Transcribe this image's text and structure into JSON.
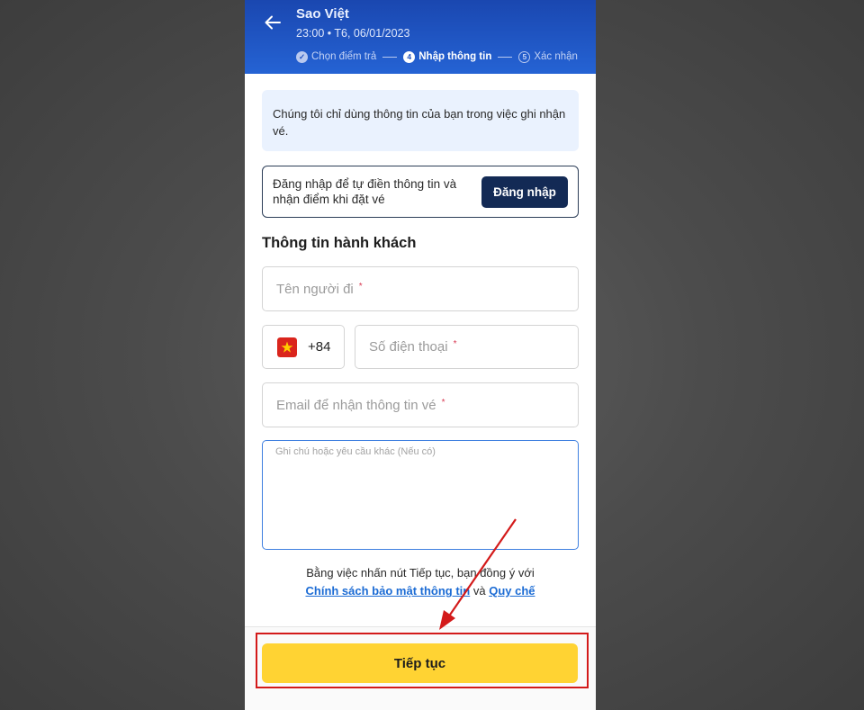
{
  "header": {
    "operator": "Sao Việt",
    "trip_time": "23:00 • T6, 06/01/2023",
    "steps": [
      {
        "number": "✓",
        "label": "Chọn điểm trả",
        "state": "done"
      },
      {
        "number": "4",
        "label": "Nhập thông tin",
        "state": "current"
      },
      {
        "number": "5",
        "label": "Xác nhận",
        "state": "next"
      }
    ]
  },
  "info_notice": "Chúng tôi chỉ dùng thông tin của bạn trong việc ghi nhận vé.",
  "login_prompt": {
    "text": "Đăng nhập để tự điền thông tin và nhận điểm khi đặt vé",
    "button_label": "Đăng nhập"
  },
  "passenger_section": {
    "title": "Thông tin hành khách",
    "name_placeholder": "Tên người đi",
    "country_code": "+84",
    "phone_placeholder": "Số điện thoại",
    "email_placeholder": "Email để nhận thông tin vé",
    "note_placeholder": "Ghi chú hoặc yêu cầu khác (Nếu có)",
    "required_mark": "*"
  },
  "agreement": {
    "prefix": "Bằng việc nhấn nút Tiếp tục, bạn đồng ý với",
    "privacy_link": "Chính sách bảo mật thông tin",
    "conjunction": "và",
    "terms_link": "Quy chế"
  },
  "continue_button": "Tiếp tục",
  "colors": {
    "header_blue": "#2563d4",
    "primary_dark": "#132a55",
    "accent_yellow": "#ffd333",
    "link_blue": "#1b6bd4",
    "annotation_red": "#d31a1a"
  }
}
